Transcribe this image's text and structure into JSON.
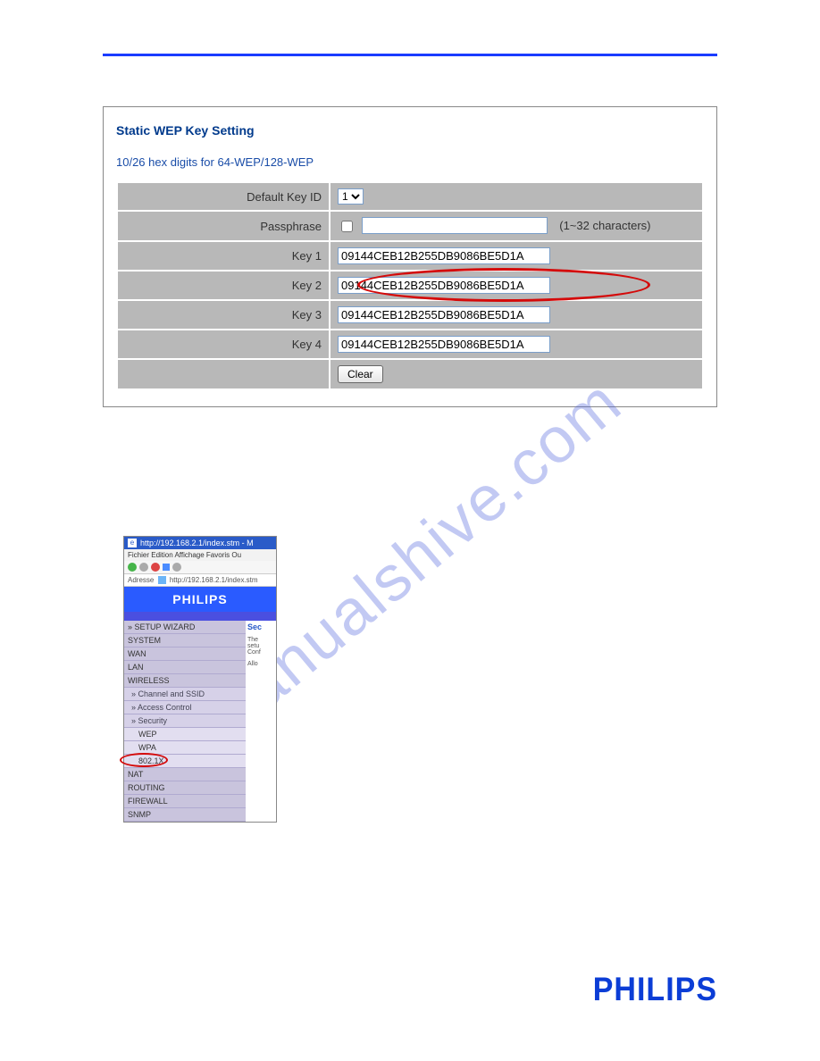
{
  "panel": {
    "title": "Static WEP Key Setting",
    "subtitle": "10/26 hex digits for 64-WEP/128-WEP",
    "rows": {
      "default_key_id": {
        "label": "Default Key ID",
        "value": "1"
      },
      "passphrase": {
        "label": "Passphrase",
        "hint": "(1~32 characters)",
        "value": ""
      },
      "key1": {
        "label": "Key 1",
        "value": "09144CEB12B255DB9086BE5D1A"
      },
      "key2": {
        "label": "Key 2",
        "value": "09144CEB12B255DB9086BE5D1A"
      },
      "key3": {
        "label": "Key 3",
        "value": "09144CEB12B255DB9086BE5D1A"
      },
      "key4": {
        "label": "Key 4",
        "value": "09144CEB12B255DB9086BE5D1A"
      },
      "clear_button": "Clear"
    }
  },
  "watermark": "manualshive.com",
  "subshot": {
    "titlebar": "http://192.168.2.1/index.stm - M",
    "menus": "Fichier  Edition  Affichage  Favoris  Ou",
    "address_label": "Adresse",
    "address_value": "http://192.168.2.1/index.stm",
    "logo": "PHILIPS",
    "right_heading": "Sec",
    "right_text1": "The",
    "right_text2": "setu",
    "right_text3": "Conf",
    "right_text4": "Allo",
    "nav": [
      {
        "txt": "» SETUP WIZARD",
        "cls": ""
      },
      {
        "txt": "SYSTEM",
        "cls": ""
      },
      {
        "txt": "WAN",
        "cls": ""
      },
      {
        "txt": "LAN",
        "cls": ""
      },
      {
        "txt": "WIRELESS",
        "cls": ""
      },
      {
        "txt": "» Channel and SSID",
        "cls": "sub"
      },
      {
        "txt": "» Access Control",
        "cls": "sub"
      },
      {
        "txt": "» Security",
        "cls": "sub"
      },
      {
        "txt": "WEP",
        "cls": "subsub"
      },
      {
        "txt": "WPA",
        "cls": "subsub"
      },
      {
        "txt": "802.1X",
        "cls": "subsub"
      },
      {
        "txt": "NAT",
        "cls": ""
      },
      {
        "txt": "ROUTING",
        "cls": ""
      },
      {
        "txt": "FIREWALL",
        "cls": ""
      },
      {
        "txt": "SNMP",
        "cls": ""
      }
    ]
  },
  "footer_logo": "PHILIPS"
}
